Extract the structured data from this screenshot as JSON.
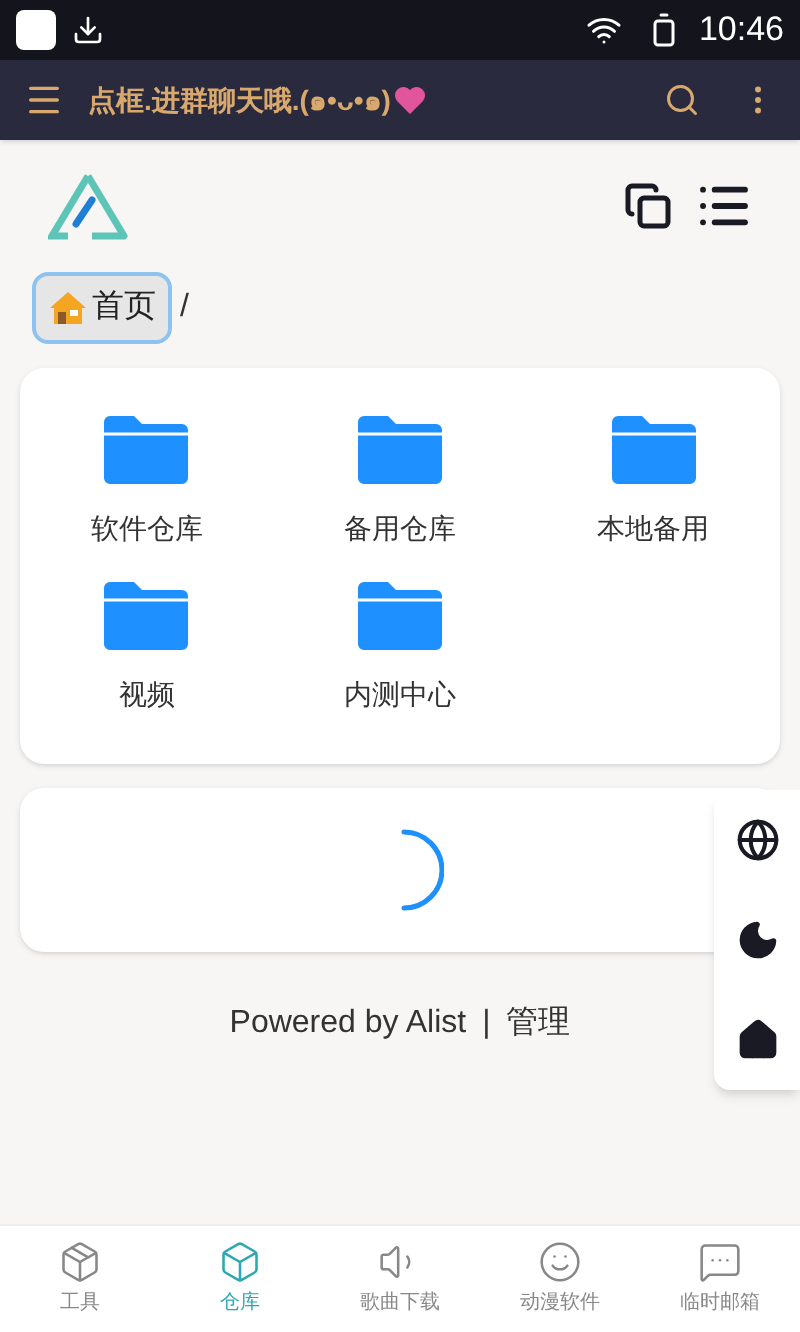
{
  "status_bar": {
    "time": "10:46"
  },
  "toolbar": {
    "title": "点框.进群聊天哦.(๑•ᴗ•๑)"
  },
  "breadcrumb": {
    "home": "首页",
    "separator": "/"
  },
  "folders": [
    {
      "name": "软件仓库"
    },
    {
      "name": "备用仓库"
    },
    {
      "name": "本地备用"
    },
    {
      "name": "视频"
    },
    {
      "name": "内测中心"
    }
  ],
  "footer": {
    "powered": "Powered by Alist",
    "divider": "|",
    "manage": "管理"
  },
  "bottom_nav": [
    {
      "label": "工具",
      "selected": false
    },
    {
      "label": "仓库",
      "selected": true
    },
    {
      "label": "歌曲下载",
      "selected": false
    },
    {
      "label": "动漫软件",
      "selected": false
    },
    {
      "label": "临时邮箱",
      "selected": false
    }
  ]
}
